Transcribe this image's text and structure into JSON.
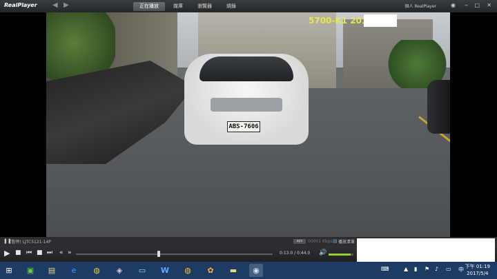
{
  "app": {
    "logo": "RealPlayer"
  },
  "nav": {
    "back_icon": "arrow-left-icon",
    "forward_icon": "arrow-right-icon"
  },
  "tabs": [
    {
      "label": "正在播放",
      "active": true
    },
    {
      "label": "媒庫"
    },
    {
      "label": "瀏覽器"
    },
    {
      "label": "燒錄"
    }
  ],
  "account": {
    "label": "個人 RealPlayer"
  },
  "video": {
    "overlay": "5700-K1 2017",
    "plate": "ABS-7606"
  },
  "info": {
    "status": "(暫停) LJTC5121-14P",
    "badge": "aps",
    "rate": "00001 Kbps",
    "mode_label": "播放清單"
  },
  "controls": {
    "time": "0:13.0 / 0:44.0",
    "position_fraction": 0.42,
    "volume_fraction": 0.9
  },
  "taskbar": {
    "start_icon": "windows-start-icon",
    "apps": [
      {
        "name": "store-icon"
      },
      {
        "name": "files-icon"
      },
      {
        "name": "ie-icon"
      },
      {
        "name": "chrome-icon"
      },
      {
        "name": "app-icon"
      },
      {
        "name": "monitor-icon"
      },
      {
        "name": "word-icon"
      },
      {
        "name": "chrome-icon-2"
      },
      {
        "name": "game-icon"
      },
      {
        "name": "folder-icon"
      },
      {
        "name": "realplayer-taskbar-icon",
        "active": true
      }
    ],
    "ime": "中",
    "time": "下午 01:19",
    "date": "2017/5/4"
  },
  "colors": {
    "accent": "#9acd32",
    "overlay_text": "#e8e84a",
    "taskbar": "#1d3c63"
  }
}
